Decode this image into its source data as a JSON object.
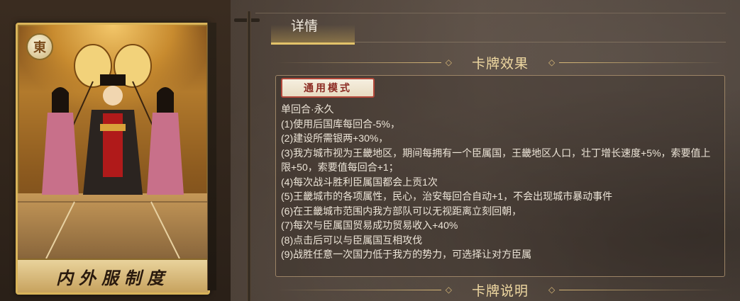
{
  "card": {
    "name": "内外服制度",
    "rarity_glyph": "東"
  },
  "tabs": [
    {
      "label": "详情",
      "active": true
    }
  ],
  "sections": {
    "effect_title": "卡牌效果",
    "description_title": "卡牌说明"
  },
  "effect": {
    "mode_badge": "通用模式",
    "lines": [
      "单回合·永久",
      "(1)使用后国库每回合-5%，",
      "(2)建设所需银两+30%，",
      "(3)我方城市视为王畿地区，期间每拥有一个臣属国，王畿地区人口，壮丁增长速度+5%，索要值上限+50，索要值每回合+1；",
      "(4)每次战斗胜利臣属国都会上贡1次",
      "(5)王畿城市的各项属性，民心，治安每回合自动+1，不会出现城市暴动事件",
      "(6)在王畿城市范围内我方部队可以无视距离立刻回朝，",
      "(7)每次与臣属国贸易成功贸易收入+40%",
      "(8)点击后可以与臣属国互相攻伐",
      "(9)战胜任意一次国力低于我方的势力，可选择让对方臣属"
    ]
  },
  "colors": {
    "gold": "#d9b978",
    "text": "#ece4d7",
    "badge_red": "#b4483a"
  }
}
